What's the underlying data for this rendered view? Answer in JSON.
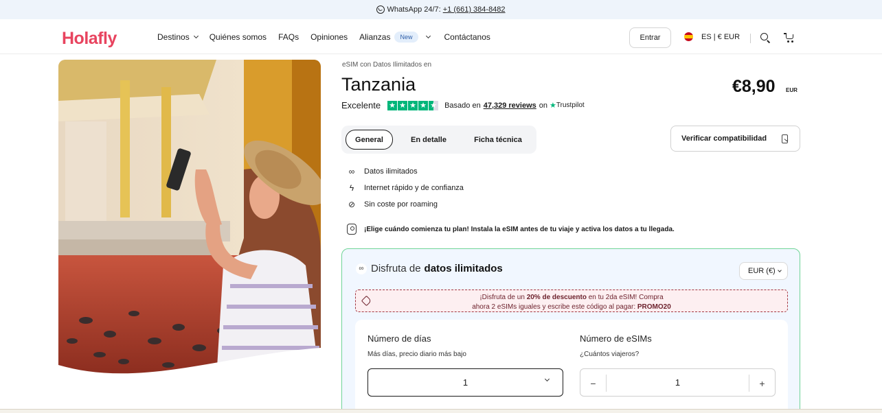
{
  "topbar": {
    "whatsapp_label": "WhatsApp 24/7:",
    "phone": "+1 (661) 384-8482"
  },
  "nav": {
    "logo": "Holafly",
    "links": [
      {
        "label": "Destinos",
        "has_dropdown": true
      },
      {
        "label": "Quiénes somos"
      },
      {
        "label": "FAQs"
      },
      {
        "label": "Opiniones"
      },
      {
        "label": "Alianzas",
        "badge": "New",
        "has_dropdown": true
      },
      {
        "label": "Contáctanos"
      }
    ],
    "login_label": "Entrar",
    "locale_label": "ES | € EUR"
  },
  "product": {
    "subheading": "eSIM con Datos Ilimitados en",
    "title": "Tanzania",
    "price": "€8,90",
    "price_currency": "EUR",
    "rating_word": "Excelente",
    "rating_stars": 4.5,
    "rating_prefix": "Basado en",
    "reviews_count": "47,329 reviews",
    "rating_on": "on",
    "trustpilot_name": "Trustpilot"
  },
  "tabs": [
    {
      "label": "General",
      "active": true
    },
    {
      "label": "En detalle",
      "active": false
    },
    {
      "label": "Ficha técnica",
      "active": false
    }
  ],
  "compat_button": "Verificar compatibilidad",
  "features": [
    {
      "icon": "infinity-icon",
      "label": "Datos ilimitados"
    },
    {
      "icon": "lightning-icon",
      "label": "Internet rápido y de confianza"
    },
    {
      "icon": "no-roaming-icon",
      "label": "Sin coste por roaming"
    }
  ],
  "notice": "¡Elige cuándo comienza tu plan! Instala la eSIM antes de tu viaje y activa los datos a tu llegada.",
  "plan": {
    "heading_prefix": "Disfruta de",
    "heading_bold": "datos ilimitados",
    "currency_select": "EUR (€)",
    "promo_part1": "¡Disfruta de un",
    "promo_bold": "20% de descuento",
    "promo_part2": "en tu 2da eSIM! Compra",
    "promo_line2": "ahora 2 eSIMs iguales y escribe este código al pagar:",
    "promo_code": "PROMO20",
    "days_label": "Número de días",
    "days_sub": "Más días, precio diario más bajo",
    "days_value": "1",
    "esims_label": "Número de eSIMs",
    "esims_sub": "¿Cuántos viajeros?",
    "esims_value": "1"
  },
  "colors": {
    "brand": "#e8445f",
    "trustpilot": "#00b67a",
    "plan_border": "#6fd497",
    "promo_text": "#6b1f2a"
  }
}
